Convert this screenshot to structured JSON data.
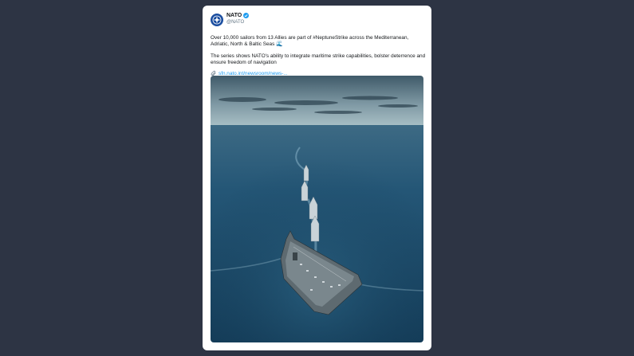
{
  "tweet": {
    "author_name": "NATO",
    "author_handle": "@NATO",
    "text_line1": "Over 10,000 sailors from 13 Allies are part of #NeptuneStrike across the Mediterranean, Adriatic, North & Baltic Seas",
    "wave_emoji": "🌊",
    "text_line2": "The series shows NATO's ability to integrate maritime strike capabilities, bolster deterrence and ensure freedom of navigation",
    "link_text": "sfn.nato.int/newsroom/news-..."
  },
  "icons": {
    "avatar": "nato-compass-logo",
    "verified": "verified-badge-icon",
    "link": "paperclip-link-icon"
  },
  "colors": {
    "background": "#2d3444",
    "link": "#1d9bf0",
    "verified": "#1d9bf0",
    "sea": "#1a4a6a"
  }
}
